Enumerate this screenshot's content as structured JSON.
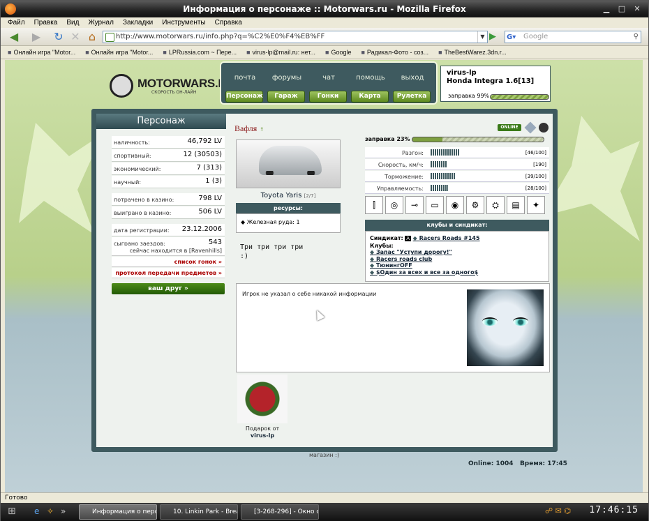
{
  "window": {
    "title": "Информация о персонаже :: Motorwars.ru - Mozilla Firefox"
  },
  "menu": [
    "Файл",
    "Правка",
    "Вид",
    "Журнал",
    "Закладки",
    "Инструменты",
    "Справка"
  ],
  "nav": {
    "url": "http://www.motorwars.ru/info.php?q=%C2%E0%F4%EB%FF",
    "search_placeholder": "Google"
  },
  "bookmarks": [
    "Онлайн игра \"Motor...",
    "Онлайн игра \"Motor...",
    "LPRussia.com ~ Пере...",
    "virus-lp@mail.ru: нет...",
    "Google",
    "Радикал-Фото - соз...",
    "TheBestWarez.3dn.r..."
  ],
  "site": {
    "logo_name": "MOTORWARS.RU",
    "logo_tag": "СКОРОСТЬ ОН-ЛАЙН",
    "top_links": [
      "почта",
      "форумы",
      "чат",
      "помощь",
      "выход"
    ],
    "top_buttons": [
      "Персонаж",
      "Гараж",
      "Гонки",
      "Карта",
      "Рулетка"
    ],
    "user": {
      "name": "virus-lp",
      "car": "Honda Integra 1.6[13]",
      "fuel_label": "заправка 99%",
      "fuel_level": 0.99
    },
    "panel_title": "Персонаж",
    "stats": [
      {
        "label": "наличность:",
        "value": "46,792 LV"
      },
      {
        "label": "спортивный:",
        "value": "12 (30503)"
      },
      {
        "label": "экономический:",
        "value": "7 (313)"
      },
      {
        "label": "научный:",
        "value": "1 (3)"
      },
      {
        "label": "потрачено в казино:",
        "value": "798 LV"
      },
      {
        "label": "выиграно в казино:",
        "value": "506 LV"
      },
      {
        "label": "дата регистрации:",
        "value": "23.12.2006"
      },
      {
        "label": "сыграно заездов:",
        "value": "543"
      }
    ],
    "location": "сейчас находится в [Ravenhills]",
    "race_list": "список гонок »",
    "transfer_log": "протокол передачи предметов »",
    "friend_btn": "ваш друг »",
    "player_name": "Вафля",
    "online": "ONLINE",
    "fuel": {
      "label": "заправка 23%",
      "level": 0.23
    },
    "car": {
      "name": "Toyota Yaris",
      "index": "[2/7]"
    },
    "resources_title": "ресурсы:",
    "resource": "Железная руда: 1",
    "quote": [
      "Три три три три",
      ":)"
    ],
    "params": [
      {
        "label": "Разгон:",
        "value": "[46/100]",
        "level": 0.46
      },
      {
        "label": "Скорость, км/ч:",
        "value": "[190]",
        "level": 0.27
      },
      {
        "label": "Торможение:",
        "value": "[39/100]",
        "level": 0.39
      },
      {
        "label": "Управляемость:",
        "value": "[28/100]",
        "level": 0.28
      }
    ],
    "clubs_title": "клубы и синдикат:",
    "syndicate_label": "Синдикат:",
    "syndicate": "Racers Roads #145",
    "clubs_label": "Клубы:",
    "clubs": [
      "Запас \"Уступи дорогу!\"",
      "Racers roads club",
      "ТюнингOFF",
      "$Один за всех и все за одного$"
    ],
    "about": "Игрок не указал о себе никакой информации",
    "gift_from": "Подарок от",
    "gift_user": "virus-lp",
    "shop": "магазин :)",
    "online_count": "Online: 1004",
    "time": "Время: 17:45"
  },
  "status": "Готово",
  "taskbar": {
    "tasks": [
      "Информация о перс...",
      "10. Linkin Park - Brea...",
      "[3-268-296] - Окно с..."
    ],
    "clock": "17:46:15"
  }
}
